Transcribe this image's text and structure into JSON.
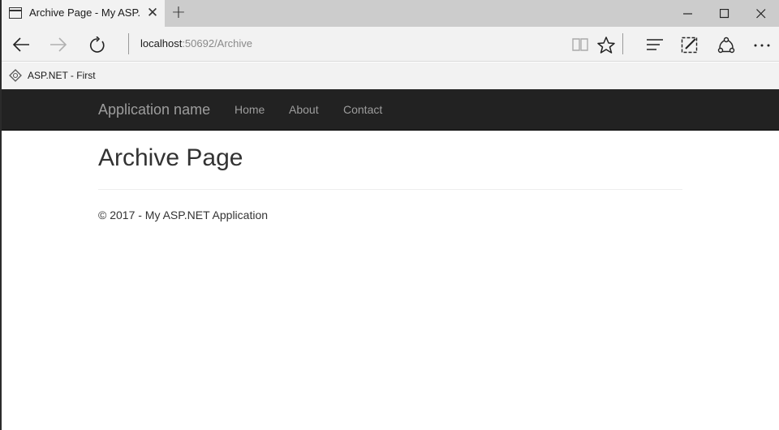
{
  "browser": {
    "tab_title": "Archive Page - My ASP.N",
    "tab_close": "✕",
    "new_tab": "+",
    "address_host": "localhost",
    "address_path": ":50692/Archive",
    "favorite_label": "ASP.NET - First"
  },
  "site": {
    "brand": "Application name",
    "nav": [
      {
        "label": "Home"
      },
      {
        "label": "About"
      },
      {
        "label": "Contact"
      }
    ]
  },
  "main": {
    "heading": "Archive Page",
    "footer": "© 2017 - My ASP.NET Application"
  },
  "colors": {
    "navbar_bg": "#222222",
    "nav_text": "#9d9d9d",
    "chrome_bg": "#f2f2f2",
    "tabstrip_bg": "#cccccc",
    "body_text": "#333333"
  },
  "icons": {
    "tab": "page-icon",
    "back": "back-arrow-icon",
    "forward": "forward-arrow-icon",
    "refresh": "refresh-icon",
    "reading_view": "reading-view-icon",
    "favorite": "star-icon",
    "hub": "hub-icon",
    "web_note": "web-note-icon",
    "share": "share-icon",
    "more": "more-icon"
  }
}
